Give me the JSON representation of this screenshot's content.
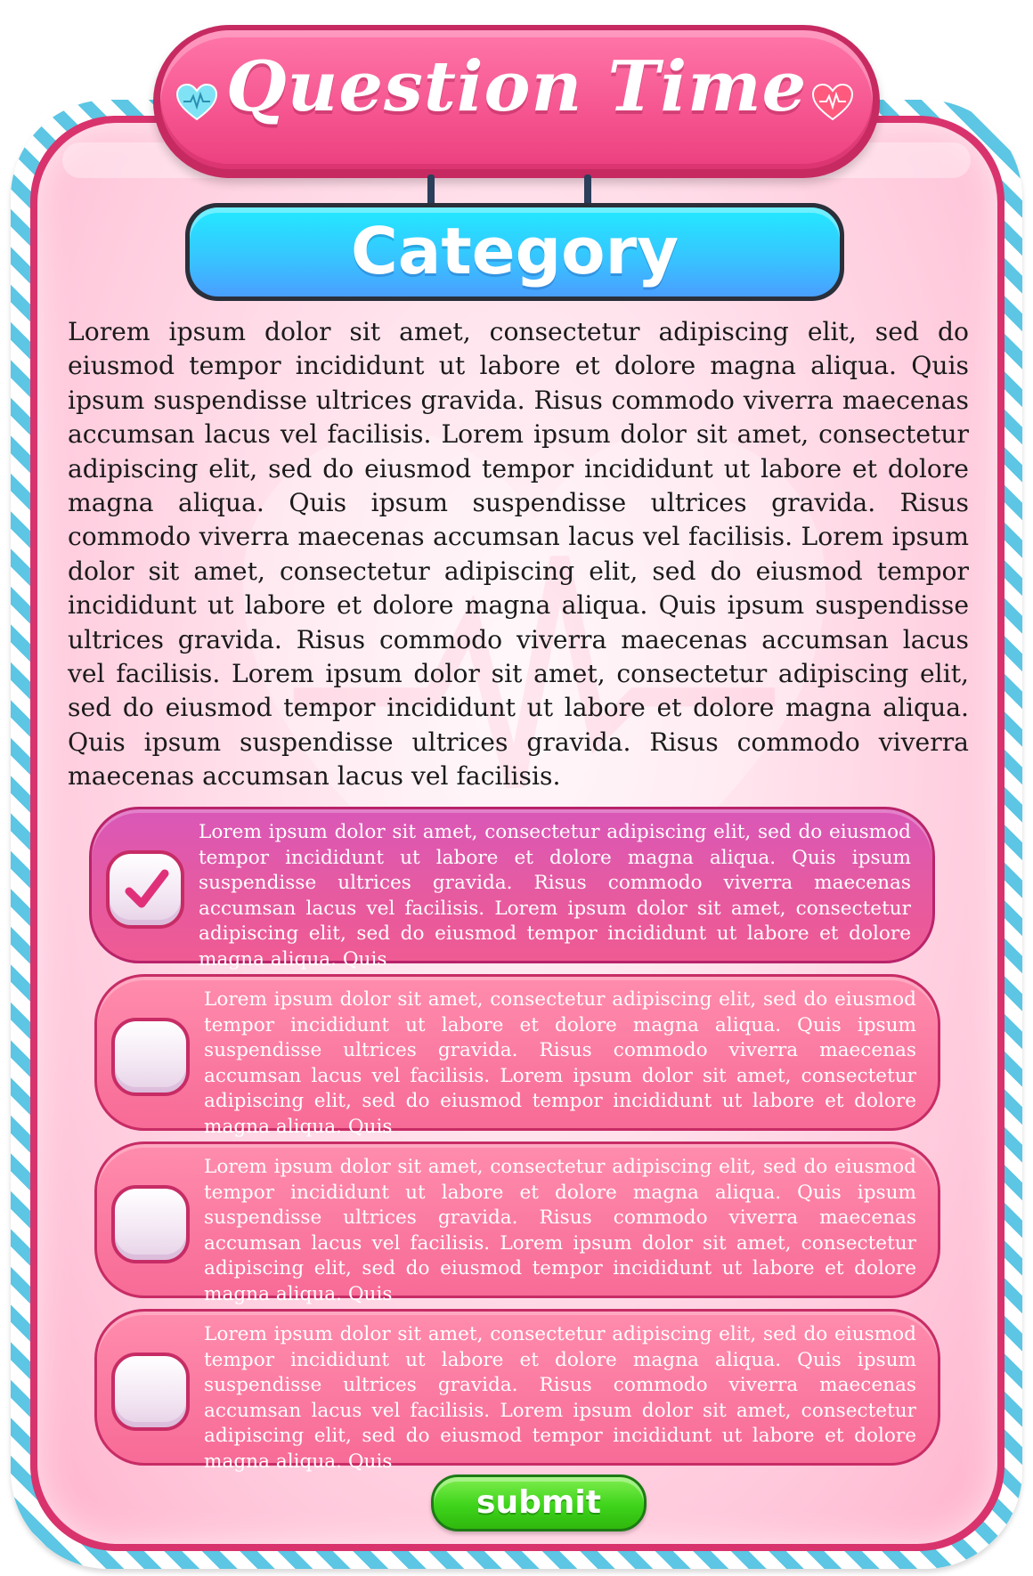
{
  "header": {
    "title": "Question Time",
    "left_icon": "heart-heartbeat-icon",
    "right_icon": "heart-heartbeat-icon",
    "left_icon_color": "#7fe3f5",
    "right_icon_color": "#ff5a7e"
  },
  "category": {
    "label": "Category"
  },
  "question": {
    "text": "Lorem ipsum dolor sit amet, consectetur adipiscing elit, sed do eiusmod tempor incididunt ut labore et dolore magna aliqua. Quis ipsum suspendisse ultrices gravida. Risus commodo viverra maecenas accumsan lacus vel facilisis. Lorem ipsum dolor sit amet, consectetur adipiscing elit, sed do eiusmod tempor incididunt ut labore et dolore magna aliqua. Quis ipsum suspendisse ultrices gravida. Risus commodo viverra maecenas accumsan lacus vel facilisis. Lorem ipsum dolor sit amet, consectetur adipiscing elit, sed do eiusmod tempor incididunt ut labore et dolore magna aliqua. Quis ipsum suspendisse ultrices gravida. Risus commodo viverra maecenas accumsan lacus vel facilisis. Lorem ipsum dolor sit amet, consectetur adipiscing elit, sed do eiusmod tempor incididunt ut labore et dolore magna aliqua. Quis ipsum suspendisse ultrices gravida. Risus commodo viverra maecenas accumsan lacus vel facilisis."
  },
  "answers": [
    {
      "text": "Lorem ipsum dolor sit amet, consectetur adipiscing elit, sed do eiusmod tempor incididunt ut labore et dolore magna aliqua. Quis ipsum suspendisse ultrices gravida. Risus commodo viverra maecenas accumsan lacus vel facilisis. Lorem ipsum dolor sit amet, consectetur adipiscing elit, sed do eiusmod tempor incididunt ut labore et dolore magna aliqua. Quis",
      "selected": true
    },
    {
      "text": "Lorem ipsum dolor sit amet, consectetur adipiscing elit, sed do eiusmod tempor incididunt ut labore et dolore magna aliqua. Quis ipsum suspendisse ultrices gravida. Risus commodo viverra maecenas accumsan lacus vel facilisis. Lorem ipsum dolor sit amet, consectetur adipiscing elit, sed do eiusmod tempor incididunt ut labore et dolore magna aliqua. Quis",
      "selected": false
    },
    {
      "text": "Lorem ipsum dolor sit amet, consectetur adipiscing elit, sed do eiusmod tempor incididunt ut labore et dolore magna aliqua. Quis ipsum suspendisse ultrices gravida. Risus commodo viverra maecenas accumsan lacus vel facilisis. Lorem ipsum dolor sit amet, consectetur adipiscing elit, sed do eiusmod tempor incididunt ut labore et dolore magna aliqua. Quis",
      "selected": false
    },
    {
      "text": "Lorem ipsum dolor sit amet, consectetur adipiscing elit, sed do eiusmod tempor incididunt ut labore et dolore magna aliqua. Quis ipsum suspendisse ultrices gravida. Risus commodo viverra maecenas accumsan lacus vel facilisis. Lorem ipsum dolor sit amet, consectetur adipiscing elit, sed do eiusmod tempor incididunt ut labore et dolore magna aliqua. Quis",
      "selected": false
    }
  ],
  "submit": {
    "label": "submit",
    "color": "#3ed41b"
  },
  "theme": {
    "frame_stripe_color": "#5cc6e4",
    "panel_border_color": "#d8336d",
    "title_color": "#f5548f",
    "category_color": "#36c6ff",
    "answer_color": "#f76b97",
    "answer_selected_color": "#e55aa2"
  }
}
